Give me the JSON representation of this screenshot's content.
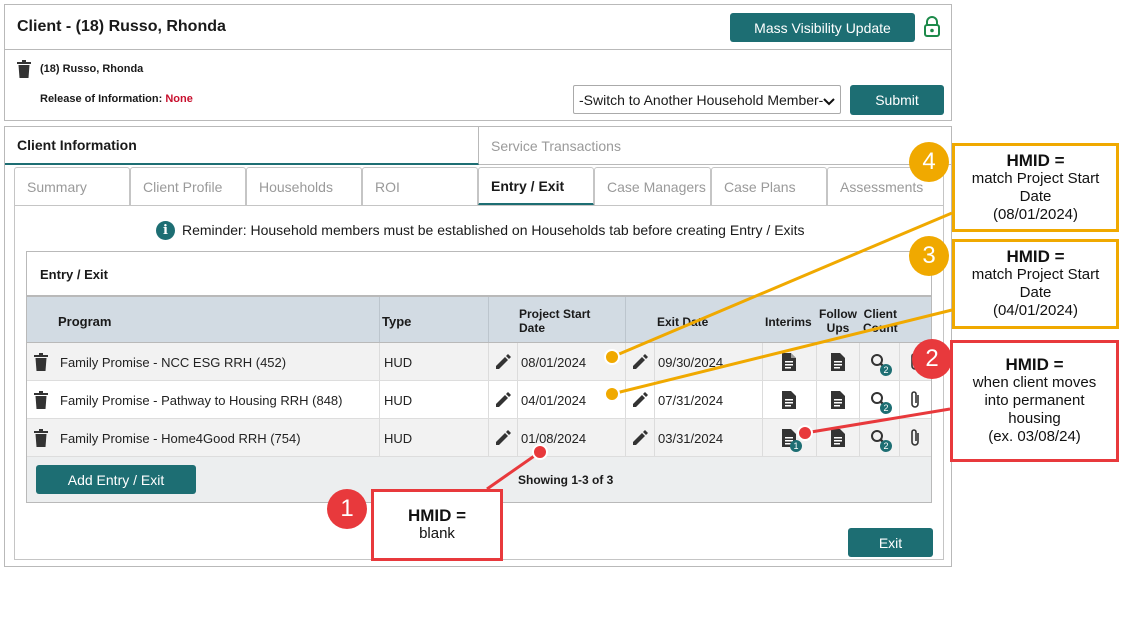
{
  "header": {
    "title": "Client - (18) Russo, Rhonda",
    "mass_visibility_label": "Mass Visibility Update"
  },
  "client_bar": {
    "client_name": "(18) Russo, Rhonda",
    "release_label": "Release of Information:",
    "release_value": "None",
    "switch_select_value": "-Switch to Another Household Member-",
    "submit_label": "Submit"
  },
  "top_tabs": [
    "Client Information",
    "Service Transactions"
  ],
  "sub_tabs": [
    "Summary",
    "Client Profile",
    "Households",
    "ROI",
    "Entry / Exit",
    "Case Managers",
    "Case Plans",
    "Assessments"
  ],
  "reminder_text": "Reminder: Household members must be established on Households tab before creating Entry / Exits",
  "entry_exit": {
    "section_title": "Entry / Exit",
    "columns": {
      "program": "Program",
      "type": "Type",
      "project_start_line1": "Project Start",
      "project_start_line2": "Date",
      "exit_date": "Exit Date",
      "interims": "Interims",
      "follow_line1": "Follow",
      "follow_line2": "Ups",
      "client_line1": "Client",
      "client_line2": "Count"
    },
    "rows": [
      {
        "program": "Family Promise - NCC ESG RRH (452)",
        "type": "HUD",
        "start": "08/01/2024",
        "exit": "09/30/2024",
        "interim_badge": "",
        "count_badge": "2"
      },
      {
        "program": "Family Promise - Pathway to Housing RRH (848)",
        "type": "HUD",
        "start": "04/01/2024",
        "exit": "07/31/2024",
        "interim_badge": "",
        "count_badge": "2"
      },
      {
        "program": "Family Promise - Home4Good RRH (754)",
        "type": "HUD",
        "start": "01/08/2024",
        "exit": "03/31/2024",
        "interim_badge": "1",
        "count_badge": "2"
      }
    ],
    "add_label": "Add Entry / Exit",
    "showing_text": "Showing 1-3 of 3",
    "exit_label": "Exit"
  },
  "callouts": [
    {
      "number": "1",
      "heading": "HMID =",
      "lines": [
        "blank"
      ]
    },
    {
      "number": "2",
      "heading": "HMID =",
      "lines": [
        "when client moves",
        "into permanent",
        "housing",
        "(ex. 03/08/24)"
      ]
    },
    {
      "number": "3",
      "heading": "HMID =",
      "lines": [
        "match Project Start",
        "Date",
        "(04/01/2024)"
      ]
    },
    {
      "number": "4",
      "heading": "HMID =",
      "lines": [
        "match Project Start",
        "Date",
        "(08/01/2024)"
      ]
    }
  ],
  "colors": {
    "teal": "#1d6e73",
    "callout_red": "#e8393c",
    "callout_orange": "#f0a900",
    "release_none": "#c8102e",
    "table_header_bg": "#d2dbe3"
  },
  "icons": [
    "trash-icon",
    "lock-icon",
    "info-icon",
    "pencil-icon",
    "document-icon",
    "search-icon",
    "paperclip-icon"
  ]
}
